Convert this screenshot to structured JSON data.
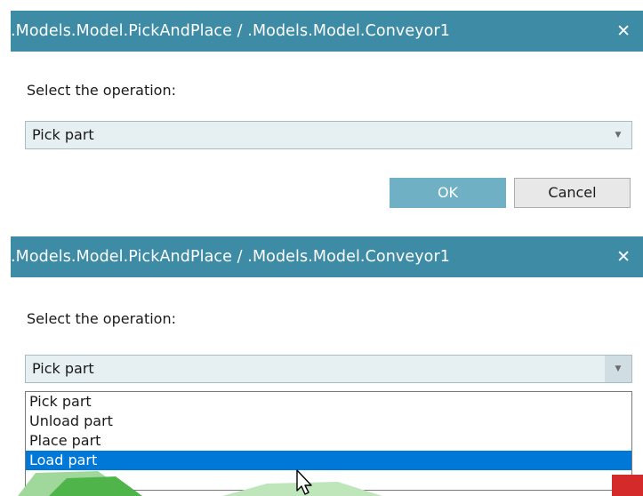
{
  "dialogs": [
    {
      "title": ".Models.Model.PickAndPlace / .Models.Model.Conveyor1",
      "prompt": "Select the operation:",
      "combo_value": "Pick part",
      "ok_label": "OK",
      "cancel_label": "Cancel"
    },
    {
      "title": ".Models.Model.PickAndPlace / .Models.Model.Conveyor1",
      "prompt": "Select the operation:",
      "combo_value": "Pick part",
      "options": [
        "Pick part",
        "Unload part",
        "Place part",
        "Load part"
      ],
      "highlighted_option": "Load part"
    }
  ],
  "icons": {
    "close": "close-icon",
    "dropdown": "chevron-down-icon",
    "cursor": "mouse-pointer-icon"
  },
  "colors": {
    "titlebar": "#3d8ba5",
    "combo_bg": "#e6f0f3",
    "ok_button": "#6fb0c4",
    "selection": "#0078d7"
  }
}
